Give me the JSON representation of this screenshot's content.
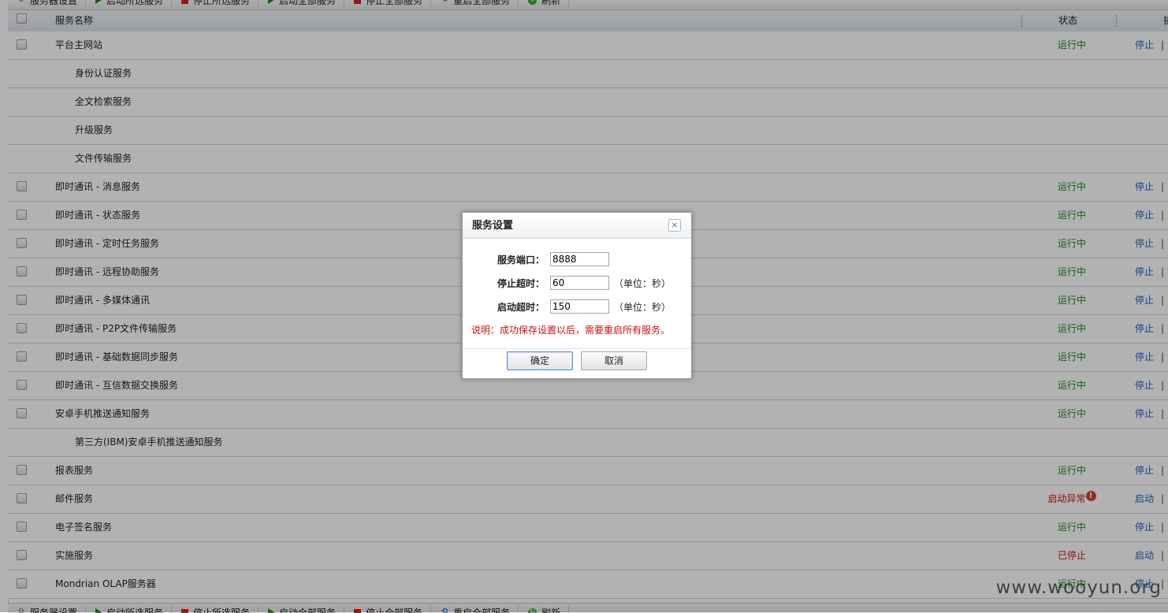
{
  "toolbar": {
    "items": [
      {
        "label": "服务器设置",
        "icon": "gear-icon"
      },
      {
        "label": "启动所选服务",
        "icon": "play-icon"
      },
      {
        "label": "停止所选服务",
        "icon": "stop-icon"
      },
      {
        "label": "启动全部服务",
        "icon": "play-icon"
      },
      {
        "label": "停止全部服务",
        "icon": "stop-icon"
      },
      {
        "label": "重启全部服务",
        "icon": "restart-icon"
      },
      {
        "label": "刷新",
        "icon": "refresh-icon"
      }
    ]
  },
  "table": {
    "header": {
      "name": "服务名称",
      "status": "状态",
      "op_partial": "操"
    },
    "rows": [
      {
        "name": "平台主网站",
        "sub": false,
        "status": "运行中",
        "status_kind": "running",
        "action": "停止"
      },
      {
        "name": "身份认证服务",
        "sub": true,
        "status": "",
        "status_kind": "",
        "action": ""
      },
      {
        "name": "全文检索服务",
        "sub": true,
        "status": "",
        "status_kind": "",
        "action": ""
      },
      {
        "name": "升级服务",
        "sub": true,
        "status": "",
        "status_kind": "",
        "action": ""
      },
      {
        "name": "文件传输服务",
        "sub": true,
        "status": "",
        "status_kind": "",
        "action": ""
      },
      {
        "name": "即时通讯 - 消息服务",
        "sub": false,
        "status": "运行中",
        "status_kind": "running",
        "action": "停止"
      },
      {
        "name": "即时通讯 - 状态服务",
        "sub": false,
        "status": "运行中",
        "status_kind": "running",
        "action": "停止"
      },
      {
        "name": "即时通讯 - 定时任务服务",
        "sub": false,
        "status": "运行中",
        "status_kind": "running",
        "action": "停止"
      },
      {
        "name": "即时通讯 - 远程协助服务",
        "sub": false,
        "status": "运行中",
        "status_kind": "running",
        "action": "停止"
      },
      {
        "name": "即时通讯 - 多媒体通讯",
        "sub": false,
        "status": "运行中",
        "status_kind": "running",
        "action": "停止"
      },
      {
        "name": "即时通讯 - P2P文件传输服务",
        "sub": false,
        "status": "运行中",
        "status_kind": "running",
        "action": "停止"
      },
      {
        "name": "即时通讯 - 基础数据同步服务",
        "sub": false,
        "status": "运行中",
        "status_kind": "running",
        "action": "停止"
      },
      {
        "name": "即时通讯 - 互信数据交换服务",
        "sub": false,
        "status": "运行中",
        "status_kind": "running",
        "action": "停止"
      },
      {
        "name": "安卓手机推送通知服务",
        "sub": false,
        "status": "运行中",
        "status_kind": "running",
        "action": "停止"
      },
      {
        "name": "第三方(IBM)安卓手机推送通知服务",
        "sub": true,
        "status": "",
        "status_kind": "",
        "action": ""
      },
      {
        "name": "报表服务",
        "sub": false,
        "status": "运行中",
        "status_kind": "running",
        "action": "停止"
      },
      {
        "name": "邮件服务",
        "sub": false,
        "status": "启动异常",
        "status_kind": "error",
        "action": "启动"
      },
      {
        "name": "电子签名服务",
        "sub": false,
        "status": "运行中",
        "status_kind": "running",
        "action": "停止"
      },
      {
        "name": "实施服务",
        "sub": false,
        "status": "已停止",
        "status_kind": "stopped",
        "action": "启动"
      },
      {
        "name": "Mondrian OLAP服务器",
        "sub": false,
        "status": "运行中",
        "status_kind": "running",
        "action": "停止"
      }
    ]
  },
  "dialog": {
    "title": "服务设置",
    "close_symbol": "×",
    "port_label": "服务端口：",
    "port_value": "8888",
    "stop_timeout_label": "停止超时：",
    "stop_timeout_value": "60",
    "start_timeout_label": "启动超时：",
    "start_timeout_value": "150",
    "unit_text": "（单位：秒）",
    "note": "说明：成功保存设置以后，需要重启所有服务。",
    "ok_label": "确定",
    "cancel_label": "取消"
  },
  "watermark": "www.wooyun.org",
  "colors": {
    "running": "#1a8a1a",
    "error": "#cc1111",
    "stopped": "#cc1111",
    "link": "#2060c8",
    "note": "#cc1111"
  }
}
